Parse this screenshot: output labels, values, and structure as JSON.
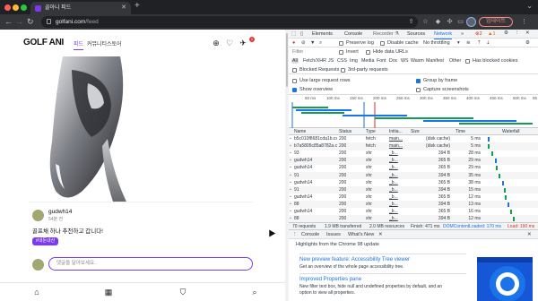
{
  "browser": {
    "tab_title": "골아니 피드",
    "url_host": "golfani.com",
    "url_path": "/feed",
    "update_label": "업데이트"
  },
  "site": {
    "logo": "GOLF ANI",
    "nav": [
      "피드",
      "커뮤니티",
      "스토어"
    ],
    "notification_count": "1",
    "post": {
      "username": "gudwh14",
      "time": "54분 전",
      "text": "골프채 하나 추천하고 갑니다!",
      "tag": "#내돈내산"
    },
    "comment_placeholder": "댓글을 달아보세요.."
  },
  "devtools": {
    "tabs": [
      "Elements",
      "Console",
      "Sources",
      "Network"
    ],
    "more_tabs": "»",
    "error_count": "2",
    "warn_count": "1",
    "toolbar": {
      "preserve_log": "Preserve log",
      "disable_cache": "Disable cache",
      "throttling": "No throttling"
    },
    "filter_label": "Filter",
    "invert": "Invert",
    "hide_data_urls": "Hide data URLs",
    "filter_types": [
      "All",
      "Fetch/XHR",
      "JS",
      "CSS",
      "Img",
      "Media",
      "Font",
      "Doc",
      "WS",
      "Wasm",
      "Manifest",
      "Other"
    ],
    "has_blocked_cookies": "Has blocked cookies",
    "blocked_requests": "Blocked Requests",
    "third_party": "3rd-party requests",
    "use_large_rows": "Use large request rows",
    "group_by_frame": "Group by frame",
    "show_overview": "Show overview",
    "capture_screenshots": "Capture screenshots",
    "ticks": [
      "50 ms",
      "100 ms",
      "150 ms",
      "200 ms",
      "250 ms",
      "300 ms",
      "350 ms",
      "400 ms",
      "450 ms",
      "500 ms",
      "55"
    ],
    "columns": [
      "Name",
      "Status",
      "Type",
      "Initia...",
      "Size",
      "Time",
      "Waterfall"
    ],
    "rows": [
      {
        "name": "b5c010f8681cda1b.css",
        "status": "200",
        "type": "fetch",
        "init": "main...",
        "size": "(disk cache)",
        "time": "5 ms"
      },
      {
        "name": "b7a5805c85a8782a.css",
        "status": "200",
        "type": "fetch",
        "init": "main...",
        "size": "(disk cache)",
        "time": "5 ms"
      },
      {
        "name": "93",
        "status": "200",
        "type": "xhr",
        "init": "_b...",
        "size": "394 B",
        "time": "28 ms"
      },
      {
        "name": "gudwh14",
        "status": "200",
        "type": "xhr",
        "init": "_b...",
        "size": "365 B",
        "time": "29 ms"
      },
      {
        "name": "gudwh14",
        "status": "200",
        "type": "xhr",
        "init": "_b...",
        "size": "365 B",
        "time": "29 ms"
      },
      {
        "name": "91",
        "status": "200",
        "type": "xhr",
        "init": "_b...",
        "size": "394 B",
        "time": "35 ms"
      },
      {
        "name": "gudwh14",
        "status": "200",
        "type": "xhr",
        "init": "_b...",
        "size": "365 B",
        "time": "38 ms"
      },
      {
        "name": "91",
        "status": "200",
        "type": "xhr",
        "init": "_b...",
        "size": "394 B",
        "time": "15 ms"
      },
      {
        "name": "gudwh14",
        "status": "200",
        "type": "xhr",
        "init": "_b...",
        "size": "365 B",
        "time": "12 ms"
      },
      {
        "name": "88",
        "status": "200",
        "type": "xhr",
        "init": "_b...",
        "size": "394 B",
        "time": "13 ms"
      },
      {
        "name": "gudwh14",
        "status": "200",
        "type": "xhr",
        "init": "_b...",
        "size": "365 B",
        "time": "16 ms"
      },
      {
        "name": "88",
        "status": "200",
        "type": "xhr",
        "init": "_b...",
        "size": "394 B",
        "time": "12 ms"
      }
    ],
    "summary": {
      "requests": "70 requests",
      "transferred": "1.9 MB transferred",
      "resources": "2.0 MB resources",
      "finish": "Finish: 471 ms",
      "dcl": "DOMContentLoaded: 170 ms",
      "load": "Load: 190 ms"
    },
    "drawer_tabs": [
      "Console",
      "Issues",
      "What's New"
    ],
    "whats_new": {
      "heading": "Highlights from the Chrome 98 update",
      "items": [
        {
          "title": "New preview feature: Accessibility Tree viewer",
          "desc": "Get an overview of the whole page accessibility tree."
        },
        {
          "title": "Improved Properties pane",
          "desc": "New filter text box, hide null and undefined properties by default, and an option to view all properties."
        }
      ]
    }
  },
  "colors": {
    "brand": "#7c3aed",
    "devtools_blue": "#1a73e8"
  }
}
